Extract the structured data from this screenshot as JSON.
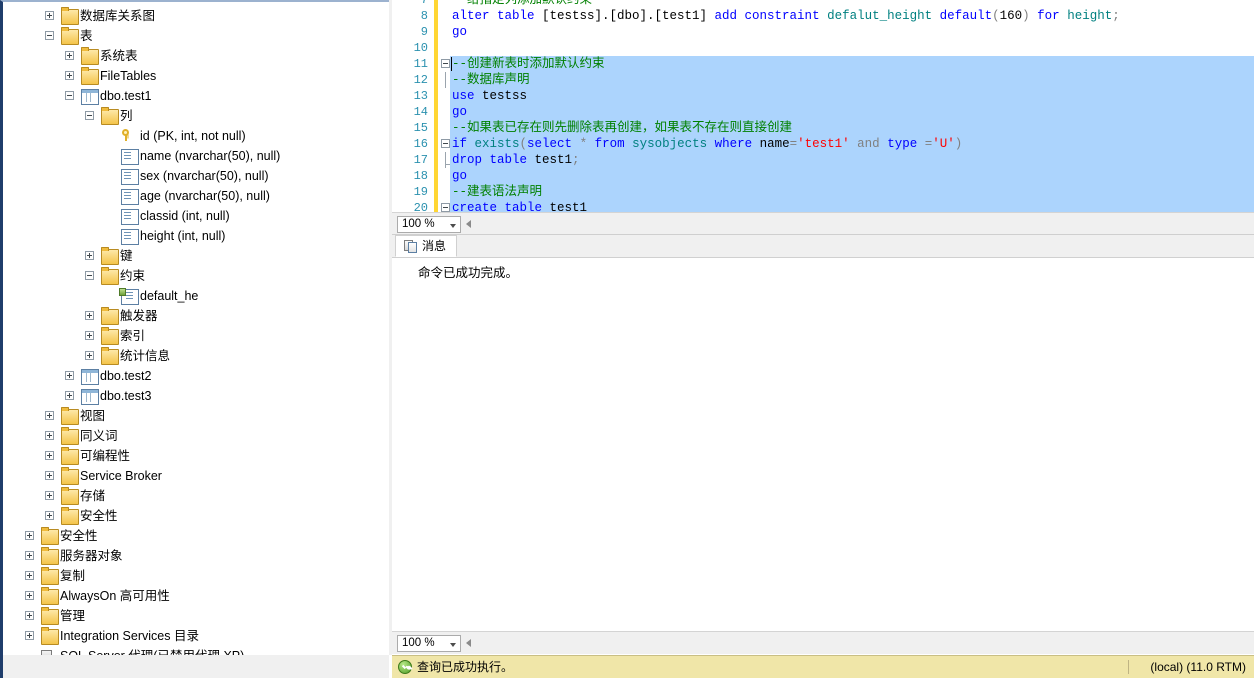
{
  "explorer": {
    "name": "object-explorer",
    "nodes": [
      {
        "indent": 1,
        "expander": "plus",
        "icon": "folder-icon",
        "label": "数据库关系图"
      },
      {
        "indent": 1,
        "expander": "minus",
        "icon": "folder-icon",
        "label": "表"
      },
      {
        "indent": 2,
        "expander": "plus",
        "icon": "folder-icon",
        "label": "系统表"
      },
      {
        "indent": 2,
        "expander": "plus",
        "icon": "folder-icon",
        "label": "FileTables"
      },
      {
        "indent": 2,
        "expander": "minus",
        "icon": "table-icon",
        "label": "dbo.test1"
      },
      {
        "indent": 3,
        "expander": "minus",
        "icon": "folder-icon",
        "label": "列"
      },
      {
        "indent": 4,
        "expander": "none",
        "icon": "key-icon",
        "label": "id (PK, int, not null)"
      },
      {
        "indent": 4,
        "expander": "none",
        "icon": "column-icon",
        "label": "name (nvarchar(50), null)"
      },
      {
        "indent": 4,
        "expander": "none",
        "icon": "column-icon",
        "label": "sex (nvarchar(50), null)"
      },
      {
        "indent": 4,
        "expander": "none",
        "icon": "column-icon",
        "label": "age (nvarchar(50), null)"
      },
      {
        "indent": 4,
        "expander": "none",
        "icon": "column-icon",
        "label": "classid (int, null)"
      },
      {
        "indent": 4,
        "expander": "none",
        "icon": "column-icon",
        "label": "height (int, null)"
      },
      {
        "indent": 3,
        "expander": "plus",
        "icon": "folder-icon",
        "label": "键"
      },
      {
        "indent": 3,
        "expander": "minus",
        "icon": "folder-icon",
        "label": "约束"
      },
      {
        "indent": 4,
        "expander": "none",
        "icon": "constraint-icon",
        "label": "default_he"
      },
      {
        "indent": 3,
        "expander": "plus",
        "icon": "folder-icon",
        "label": "触发器"
      },
      {
        "indent": 3,
        "expander": "plus",
        "icon": "folder-icon",
        "label": "索引"
      },
      {
        "indent": 3,
        "expander": "plus",
        "icon": "folder-icon",
        "label": "统计信息"
      },
      {
        "indent": 2,
        "expander": "plus",
        "icon": "table-icon",
        "label": "dbo.test2"
      },
      {
        "indent": 2,
        "expander": "plus",
        "icon": "table-icon",
        "label": "dbo.test3"
      },
      {
        "indent": 1,
        "expander": "plus",
        "icon": "folder-icon",
        "label": "视图"
      },
      {
        "indent": 1,
        "expander": "plus",
        "icon": "folder-icon",
        "label": "同义词"
      },
      {
        "indent": 1,
        "expander": "plus",
        "icon": "folder-icon",
        "label": "可编程性"
      },
      {
        "indent": 1,
        "expander": "plus",
        "icon": "folder-icon",
        "label": "Service Broker"
      },
      {
        "indent": 1,
        "expander": "plus",
        "icon": "folder-icon",
        "label": "存储"
      },
      {
        "indent": 1,
        "expander": "plus",
        "icon": "folder-icon",
        "label": "安全性"
      },
      {
        "indent": 0,
        "expander": "plus",
        "icon": "folder-icon",
        "label": "安全性"
      },
      {
        "indent": 0,
        "expander": "plus",
        "icon": "folder-icon",
        "label": "服务器对象"
      },
      {
        "indent": 0,
        "expander": "plus",
        "icon": "folder-icon",
        "label": "复制"
      },
      {
        "indent": 0,
        "expander": "plus",
        "icon": "folder-icon",
        "label": "AlwaysOn 高可用性"
      },
      {
        "indent": 0,
        "expander": "plus",
        "icon": "folder-icon",
        "label": "管理"
      },
      {
        "indent": 0,
        "expander": "plus",
        "icon": "folder-icon",
        "label": "Integration Services 目录"
      },
      {
        "indent": 0,
        "expander": "none",
        "icon": "agent-icon",
        "label": "SQL Server 代理(已禁用代理 XP)"
      }
    ]
  },
  "editor": {
    "name": "sql-query-editor",
    "lines": [
      {
        "num": "7",
        "text": "给指定列添加默认约束",
        "clipped": true,
        "tokens": [
          {
            "t": "--给指定列添加默认约束",
            "c": "cm"
          }
        ]
      },
      {
        "num": "8",
        "tokens": [
          {
            "t": "alter table ",
            "c": "k"
          },
          {
            "t": "[testss].[dbo].[test1] ",
            "c": "pl"
          },
          {
            "t": "add constraint ",
            "c": "k"
          },
          {
            "t": "defalut_height ",
            "c": "sys"
          },
          {
            "t": "default",
            "c": "k"
          },
          {
            "t": "(",
            "c": "gy"
          },
          {
            "t": "160",
            "c": "pl"
          },
          {
            "t": ") ",
            "c": "gy"
          },
          {
            "t": "for ",
            "c": "k"
          },
          {
            "t": "height",
            "c": "sys"
          },
          {
            "t": ";",
            "c": "gy"
          }
        ]
      },
      {
        "num": "9",
        "tokens": [
          {
            "t": "go",
            "c": "k"
          }
        ]
      },
      {
        "num": "10",
        "tokens": []
      },
      {
        "num": "11",
        "fold": "start",
        "selected": true,
        "caret": true,
        "tokens": [
          {
            "t": "--创建新表时添加默认约束",
            "c": "cm"
          }
        ]
      },
      {
        "num": "12",
        "fold": "line",
        "selected": true,
        "tokens": [
          {
            "t": "--数据库声明",
            "c": "cm"
          }
        ]
      },
      {
        "num": "13",
        "selected": true,
        "tokens": [
          {
            "t": "use ",
            "c": "k"
          },
          {
            "t": "testss",
            "c": "pl"
          }
        ]
      },
      {
        "num": "14",
        "selected": true,
        "tokens": [
          {
            "t": "go",
            "c": "k"
          }
        ]
      },
      {
        "num": "15",
        "selected": true,
        "tokens": [
          {
            "t": "--如果表已存在则先删除表再创建，如果表不存在则直接创建",
            "c": "cm"
          }
        ]
      },
      {
        "num": "16",
        "fold": "start",
        "selected": true,
        "tokens": [
          {
            "t": "if ",
            "c": "k"
          },
          {
            "t": "exists",
            "c": "sys"
          },
          {
            "t": "(",
            "c": "gy"
          },
          {
            "t": "select ",
            "c": "k"
          },
          {
            "t": "* ",
            "c": "gy"
          },
          {
            "t": "from ",
            "c": "k"
          },
          {
            "t": "sysobjects ",
            "c": "sys"
          },
          {
            "t": "where ",
            "c": "k"
          },
          {
            "t": "name",
            "c": "pl"
          },
          {
            "t": "=",
            "c": "gy"
          },
          {
            "t": "'test1'",
            "c": "st"
          },
          {
            "t": " and ",
            "c": "gy"
          },
          {
            "t": "type ",
            "c": "k"
          },
          {
            "t": "=",
            "c": "gy"
          },
          {
            "t": "'U'",
            "c": "st"
          },
          {
            "t": ")",
            "c": "gy"
          }
        ]
      },
      {
        "num": "17",
        "fold": "line-end",
        "selected": true,
        "tokens": [
          {
            "t": "drop table ",
            "c": "k"
          },
          {
            "t": "test1",
            "c": "pl"
          },
          {
            "t": ";",
            "c": "gy"
          }
        ]
      },
      {
        "num": "18",
        "selected": true,
        "tokens": [
          {
            "t": "go",
            "c": "k"
          }
        ]
      },
      {
        "num": "19",
        "selected": true,
        "tokens": [
          {
            "t": "--建表语法声明",
            "c": "cm"
          }
        ]
      },
      {
        "num": "20",
        "fold": "start",
        "selected": true,
        "tokens": [
          {
            "t": "create table ",
            "c": "k"
          },
          {
            "t": "test1",
            "c": "pl"
          }
        ]
      }
    ]
  },
  "zoom_top": {
    "value": "100 %",
    "name": "editor-zoom-combo"
  },
  "zoom_bottom": {
    "value": "100 %",
    "name": "results-zoom-combo"
  },
  "results": {
    "tab_label": "消息",
    "message": "命令已成功完成。"
  },
  "status": {
    "text": "查询已成功执行。",
    "server": "(local) (11.0 RTM)"
  },
  "colors": {
    "selection": "#acd4fd",
    "status_bg": "#f0e6a8",
    "modified_marker": "#ffd633",
    "keyword": "#0000ff",
    "comment": "#008000",
    "string": "#ff0000",
    "system": "#008080",
    "line_number": "#2b91af"
  }
}
